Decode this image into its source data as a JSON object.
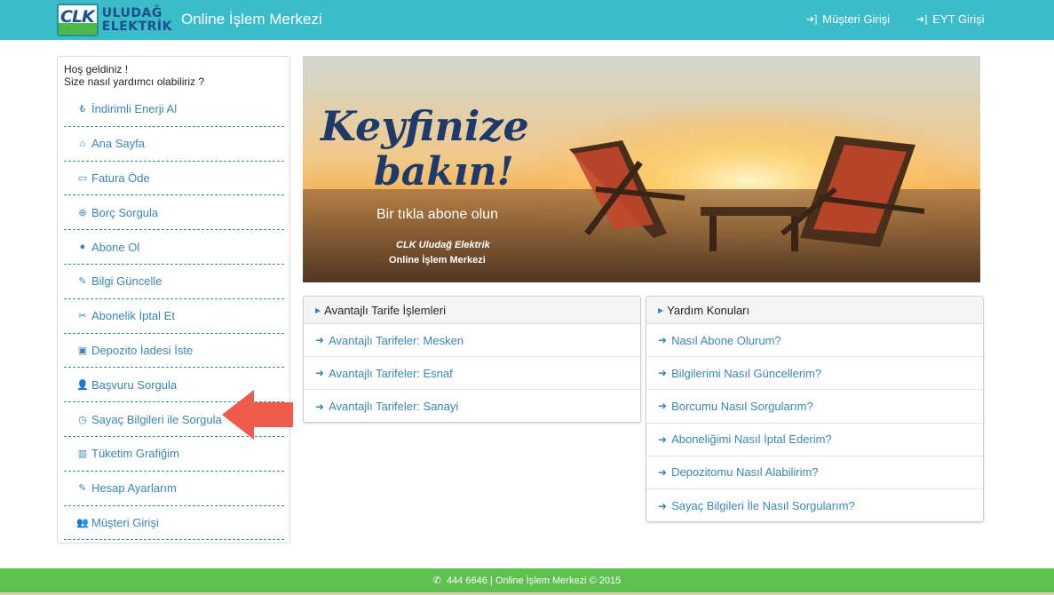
{
  "header": {
    "logo_mark": "CLK",
    "logo_line1": "ULUDAĞ",
    "logo_line2": "ELEKTRİK",
    "app_title": "Online İşlem Merkezi",
    "links": [
      {
        "label": "Müşteri Girişi",
        "icon": "sign-in-icon"
      },
      {
        "label": "EYT Girişi",
        "icon": "sign-in-icon"
      }
    ]
  },
  "sidebar": {
    "welcome_line1": "Hoş geldiniz !",
    "welcome_line2": "Size nasıl yardımcı olabiliriz ?",
    "items": [
      {
        "label": "İndirimli Enerji Al",
        "icon": "lira-icon",
        "glyph": "₺"
      },
      {
        "label": "Ana Sayfa",
        "icon": "home-icon",
        "glyph": "⌂"
      },
      {
        "label": "Fatura Öde",
        "icon": "credit-card-icon",
        "glyph": "▭"
      },
      {
        "label": "Borç Sorgula",
        "icon": "search-plus-icon",
        "glyph": "⊕"
      },
      {
        "label": "Abone Ol",
        "icon": "globe-icon",
        "glyph": "●"
      },
      {
        "label": "Bilgi Güncelle",
        "icon": "edit-icon",
        "glyph": "✎"
      },
      {
        "label": "Abonelik İptal Et",
        "icon": "scissors-icon",
        "glyph": "✂"
      },
      {
        "label": "Depozito İadesi İste",
        "icon": "money-icon",
        "glyph": "▣"
      },
      {
        "label": "Başvuru Sorgula",
        "icon": "user-plus-icon",
        "glyph": "👤"
      },
      {
        "label": "Sayaç Bilgileri ile Sorgula",
        "icon": "clock-icon",
        "glyph": "◷"
      },
      {
        "label": "Tüketim Grafiğim",
        "icon": "bar-chart-icon",
        "glyph": "▥"
      },
      {
        "label": "Hesap Ayarlarım",
        "icon": "edit-icon",
        "glyph": "✎"
      },
      {
        "label": "Müşteri Girişi",
        "icon": "users-icon",
        "glyph": "👥"
      }
    ]
  },
  "banner": {
    "headline1": "Keyfinize",
    "headline2": "bakın!",
    "subtitle": "Bir tıkla abone olun",
    "brand1": "CLK Uludağ Elektrik",
    "brand2": "Online İşlem Merkezi"
  },
  "tariff_panel": {
    "title": "Avantajlı Tarife İşlemleri",
    "items": [
      "Avantajlı Tarifeler: Mesken",
      "Avantajlı Tarifeler: Esnaf",
      "Avantajlı Tarifeler: Sanayi"
    ]
  },
  "help_panel": {
    "title": "Yardım Konuları",
    "items": [
      "Nasıl Abone Olurum?",
      "Bilgilerimi Nasıl Güncellerim?",
      "Borcumu Nasıl Sorgularım?",
      "Aboneliğimi Nasıl İptal Ederim?",
      "Depozitomu Nasıl Alabilirim?",
      "Sayaç Bilgileri İle Nasıl Sorgularım?"
    ]
  },
  "footer": {
    "text": "444 6646 | Online İşlem Merkezi © 2015",
    "icon": "phone-icon"
  },
  "colors": {
    "header_bg": "#3bbcc9",
    "link": "#3a86b3",
    "footer_bg": "#5dc04f",
    "arrow": "#f05a4a"
  }
}
